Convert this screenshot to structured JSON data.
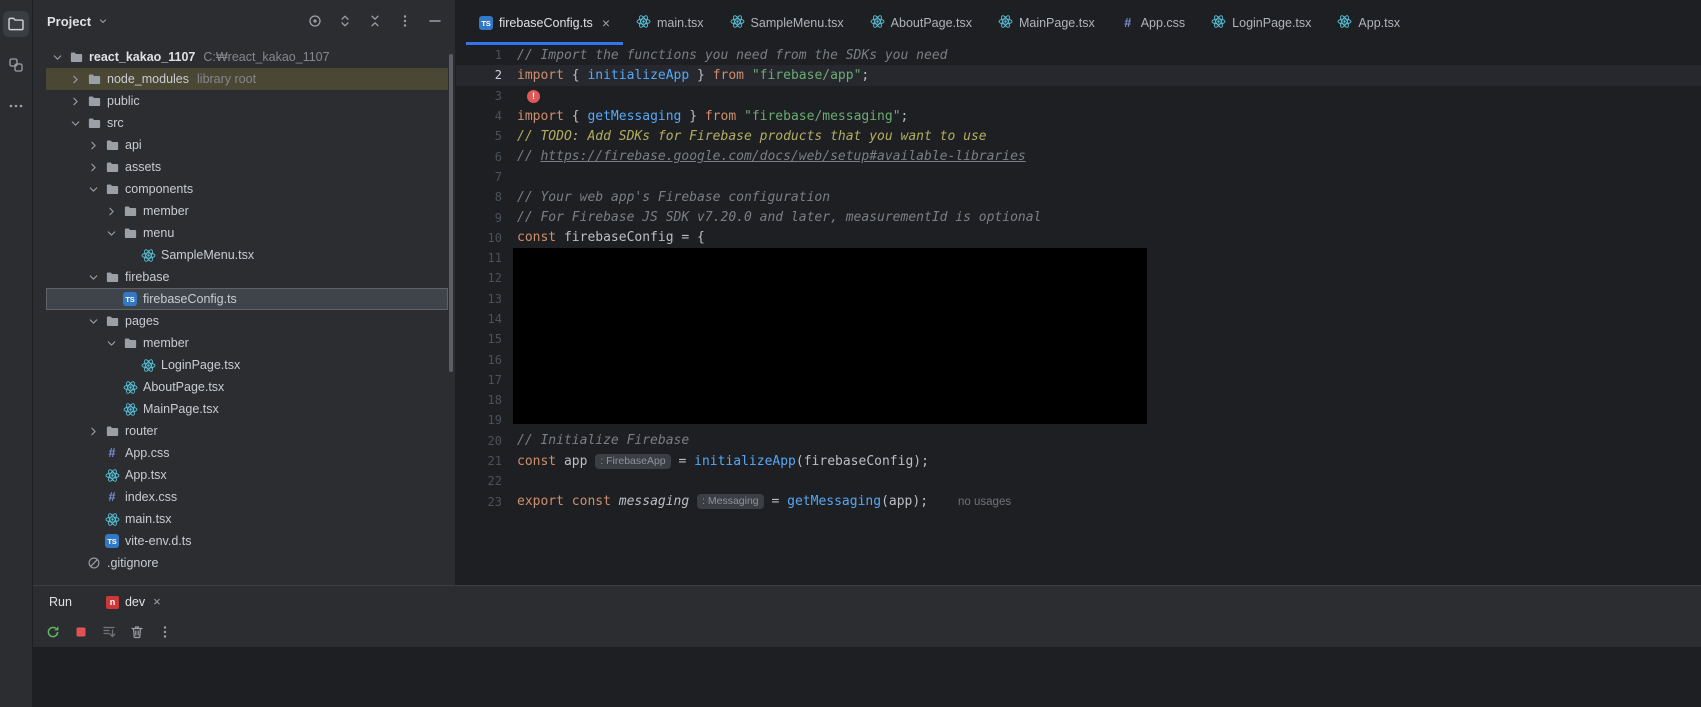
{
  "colors": {
    "accent_blue": "#3574f0",
    "editor_bg": "#1e1f22",
    "panel_bg": "#2b2d30",
    "selection_bg": "#3f434a",
    "library_root_bg": "#4a4735",
    "keyword": "#cf8e6d",
    "string": "#6aab73",
    "function_call": "#56a8f5",
    "comment": "#7a7e85",
    "todo": "#b3ae60",
    "error_red": "#e05757",
    "react_icon": "#58c4dc",
    "ts_icon": "#3178c6",
    "npm_icon": "#cb3837"
  },
  "left_stripe": {
    "buttons": [
      {
        "name": "project",
        "active": true
      },
      {
        "name": "structure",
        "active": false
      },
      {
        "name": "more-tool-windows",
        "active": false
      }
    ]
  },
  "project_panel": {
    "title": "Project",
    "header_icons": [
      "locate-opened-file",
      "expand-all",
      "collapse-all",
      "options",
      "hide"
    ],
    "tree": [
      {
        "label": "react_kakao_1107",
        "suffix": "C:₩react_kakao_1107",
        "level": 0,
        "icon": "folder",
        "expanded": true,
        "bold": true
      },
      {
        "label": "node_modules",
        "suffix": "library root",
        "level": 1,
        "icon": "folder",
        "expanded": false,
        "highlight": "library"
      },
      {
        "label": "public",
        "level": 1,
        "icon": "folder",
        "expanded": false
      },
      {
        "label": "src",
        "level": 1,
        "icon": "folder",
        "expanded": true
      },
      {
        "label": "api",
        "level": 2,
        "icon": "folder",
        "expanded": false
      },
      {
        "label": "assets",
        "level": 2,
        "icon": "folder",
        "expanded": false
      },
      {
        "label": "components",
        "level": 2,
        "icon": "folder",
        "expanded": true
      },
      {
        "label": "member",
        "level": 3,
        "icon": "folder",
        "expanded": false
      },
      {
        "label": "menu",
        "level": 3,
        "icon": "folder",
        "expanded": true
      },
      {
        "label": "SampleMenu.tsx",
        "level": 4,
        "icon": "react"
      },
      {
        "label": "firebase",
        "level": 2,
        "icon": "folder",
        "expanded": true
      },
      {
        "label": "firebaseConfig.ts",
        "level": 3,
        "icon": "ts",
        "selected": true
      },
      {
        "label": "pages",
        "level": 2,
        "icon": "folder",
        "expanded": true
      },
      {
        "label": "member",
        "level": 3,
        "icon": "folder",
        "expanded": true
      },
      {
        "label": "LoginPage.tsx",
        "level": 4,
        "icon": "react"
      },
      {
        "label": "AboutPage.tsx",
        "level": 3,
        "icon": "react"
      },
      {
        "label": "MainPage.tsx",
        "level": 3,
        "icon": "react"
      },
      {
        "label": "router",
        "level": 2,
        "icon": "folder",
        "expanded": false
      },
      {
        "label": "App.css",
        "level": 2,
        "icon": "css"
      },
      {
        "label": "App.tsx",
        "level": 2,
        "icon": "react"
      },
      {
        "label": "index.css",
        "level": 2,
        "icon": "css"
      },
      {
        "label": "main.tsx",
        "level": 2,
        "icon": "react"
      },
      {
        "label": "vite-env.d.ts",
        "level": 2,
        "icon": "ts"
      },
      {
        "label": ".gitignore",
        "level": 1,
        "icon": "gitignore"
      }
    ]
  },
  "editor": {
    "close_glyph": "×",
    "tabs": [
      {
        "label": "firebaseConfig.ts",
        "icon": "ts",
        "active": true,
        "closable": true
      },
      {
        "label": "main.tsx",
        "icon": "react"
      },
      {
        "label": "SampleMenu.tsx",
        "icon": "react"
      },
      {
        "label": "AboutPage.tsx",
        "icon": "react"
      },
      {
        "label": "MainPage.tsx",
        "icon": "react"
      },
      {
        "label": "App.css",
        "icon": "css"
      },
      {
        "label": "LoginPage.tsx",
        "icon": "react"
      },
      {
        "label": "App.tsx",
        "icon": "react"
      }
    ],
    "current_line": 2,
    "total_lines": 23,
    "redacted_block": {
      "from_line": 11,
      "to_line": 19
    },
    "lines": [
      {
        "n": 1,
        "segs": [
          {
            "c": "com",
            "t": "// Import the functions you need from the SDKs you need"
          }
        ]
      },
      {
        "n": 2,
        "segs": [
          {
            "c": "kw",
            "t": "import"
          },
          {
            "c": "pl",
            "t": " { "
          },
          {
            "c": "fn",
            "t": "initializeApp"
          },
          {
            "c": "pl",
            "t": " } "
          },
          {
            "c": "kw",
            "t": "from"
          },
          {
            "c": "pl",
            "t": " "
          },
          {
            "c": "str",
            "t": "\"firebase/app\""
          },
          {
            "c": "pl",
            "t": ";"
          }
        ]
      },
      {
        "n": 3,
        "segs": [
          {
            "c": "err",
            "t": "!"
          }
        ]
      },
      {
        "n": 4,
        "segs": [
          {
            "c": "kw",
            "t": "import"
          },
          {
            "c": "pl",
            "t": " { "
          },
          {
            "c": "fn",
            "t": "getMessaging"
          },
          {
            "c": "pl",
            "t": " } "
          },
          {
            "c": "kw",
            "t": "from"
          },
          {
            "c": "pl",
            "t": " "
          },
          {
            "c": "str",
            "t": "\"firebase/messaging\""
          },
          {
            "c": "pl",
            "t": ";"
          }
        ]
      },
      {
        "n": 5,
        "segs": [
          {
            "c": "todo",
            "t": "// TODO: Add SDKs for Firebase products that you want to use"
          }
        ]
      },
      {
        "n": 6,
        "segs": [
          {
            "c": "com",
            "t": "// "
          },
          {
            "c": "link",
            "t": "https://firebase.google.com/docs/web/setup#available-libraries"
          }
        ]
      },
      {
        "n": 7,
        "segs": []
      },
      {
        "n": 8,
        "segs": [
          {
            "c": "com",
            "t": "// Your web app's Firebase configuration"
          }
        ]
      },
      {
        "n": 9,
        "segs": [
          {
            "c": "com",
            "t": "// For Firebase JS SDK v7.20.0 and later, measurementId is optional"
          }
        ]
      },
      {
        "n": 10,
        "segs": [
          {
            "c": "kw",
            "t": "const"
          },
          {
            "c": "pl",
            "t": " firebaseConfig = {"
          }
        ]
      },
      {
        "n": 11,
        "segs": []
      },
      {
        "n": 12,
        "segs": []
      },
      {
        "n": 13,
        "segs": []
      },
      {
        "n": 14,
        "segs": []
      },
      {
        "n": 15,
        "segs": []
      },
      {
        "n": 16,
        "segs": []
      },
      {
        "n": 17,
        "segs": []
      },
      {
        "n": 18,
        "segs": []
      },
      {
        "n": 19,
        "segs": []
      },
      {
        "n": 20,
        "segs": [
          {
            "c": "com",
            "t": "// Initialize Firebase"
          }
        ]
      },
      {
        "n": 21,
        "segs": [
          {
            "c": "kw",
            "t": "const"
          },
          {
            "c": "pl",
            "t": " app "
          },
          {
            "c": "inlay",
            "t": ": FirebaseApp"
          },
          {
            "c": "pl",
            "t": " = "
          },
          {
            "c": "fn",
            "t": "initializeApp"
          },
          {
            "c": "pl",
            "t": "(firebaseConfig);"
          }
        ]
      },
      {
        "n": 22,
        "segs": []
      },
      {
        "n": 23,
        "segs": [
          {
            "c": "kw",
            "t": "export"
          },
          {
            "c": "pl",
            "t": " "
          },
          {
            "c": "kw",
            "t": "const"
          },
          {
            "c": "em",
            "t": " messaging "
          },
          {
            "c": "inlay",
            "t": ": Messaging"
          },
          {
            "c": "pl",
            "t": " = "
          },
          {
            "c": "fn",
            "t": "getMessaging"
          },
          {
            "c": "pl",
            "t": "(app);"
          },
          {
            "c": "usage",
            "t": "no usages"
          }
        ]
      }
    ]
  },
  "run_panel": {
    "title": "Run",
    "tab": {
      "label": "dev",
      "icon": "npm",
      "closable": true
    },
    "toolbar": [
      "rerun",
      "stop",
      "scroll-to-end",
      "clear-all",
      "more"
    ]
  }
}
